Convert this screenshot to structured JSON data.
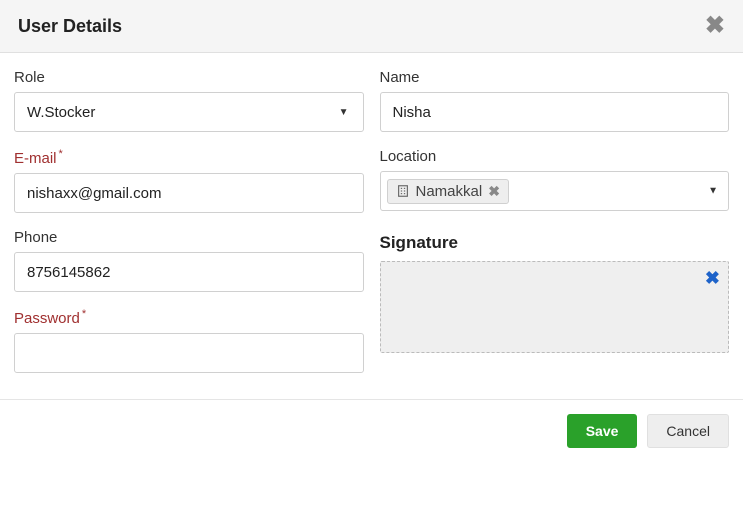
{
  "dialog": {
    "title": "User Details"
  },
  "labels": {
    "role": "Role",
    "name": "Name",
    "email": "E-mail",
    "location": "Location",
    "phone": "Phone",
    "password": "Password",
    "signature": "Signature",
    "asterisk": "*"
  },
  "values": {
    "role": "W.Stocker",
    "name": "Nisha",
    "email": "nishaxx@gmail.com",
    "phone": "8756145862",
    "password": "",
    "location_tags": [
      "Namakkal"
    ]
  },
  "buttons": {
    "save": "Save",
    "cancel": "Cancel"
  },
  "glyphs": {
    "close": "✖",
    "caret": "▼",
    "tag_remove": "✖",
    "sig_clear": "✖"
  }
}
